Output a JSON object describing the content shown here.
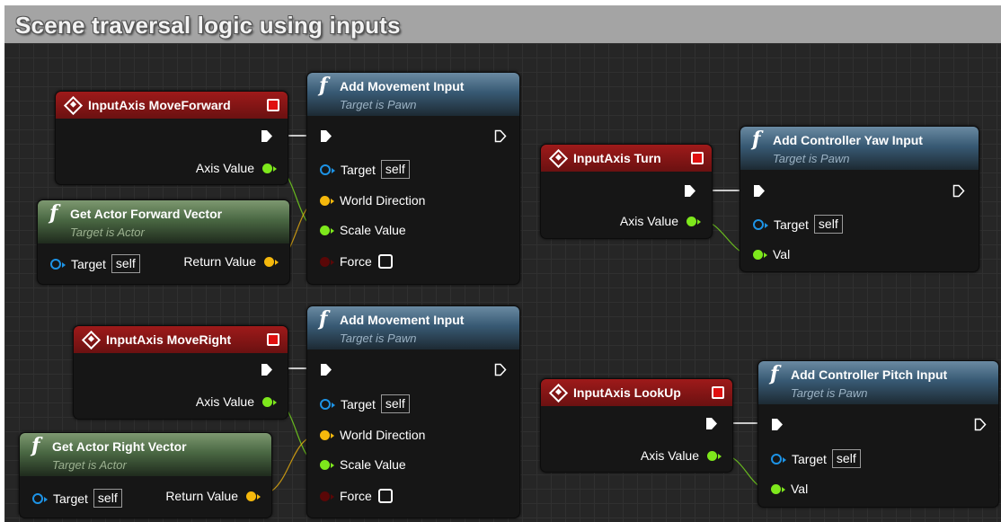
{
  "comment_title": "Scene traversal logic using inputs",
  "common": {
    "axis_value": "Axis Value",
    "target": "Target",
    "self": "self",
    "return_value": "Return Value",
    "world_direction": "World Direction",
    "scale_value": "Scale Value",
    "force": "Force",
    "val": "Val"
  },
  "nodes": {
    "input_move_forward": {
      "title": "InputAxis MoveForward"
    },
    "add_movement_1": {
      "title": "Add Movement Input",
      "subtitle": "Target is Pawn"
    },
    "get_forward_vector": {
      "title": "Get Actor Forward Vector",
      "subtitle": "Target is Actor"
    },
    "input_turn": {
      "title": "InputAxis Turn"
    },
    "add_yaw": {
      "title": "Add Controller Yaw Input",
      "subtitle": "Target is Pawn"
    },
    "input_move_right": {
      "title": "InputAxis MoveRight"
    },
    "add_movement_2": {
      "title": "Add Movement Input",
      "subtitle": "Target is Pawn"
    },
    "get_right_vector": {
      "title": "Get Actor Right Vector",
      "subtitle": "Target is Actor"
    },
    "input_lookup": {
      "title": "InputAxis LookUp"
    },
    "add_pitch": {
      "title": "Add Controller Pitch Input",
      "subtitle": "Target is Pawn"
    }
  },
  "colors": {
    "float_pin": "#7ee81c",
    "vector_pin": "#f5b80c",
    "object_pin": "#1d93e6",
    "event_header": "#9e1a1a",
    "function_header": "#385a74",
    "pure_function_header": "#4a6843"
  }
}
